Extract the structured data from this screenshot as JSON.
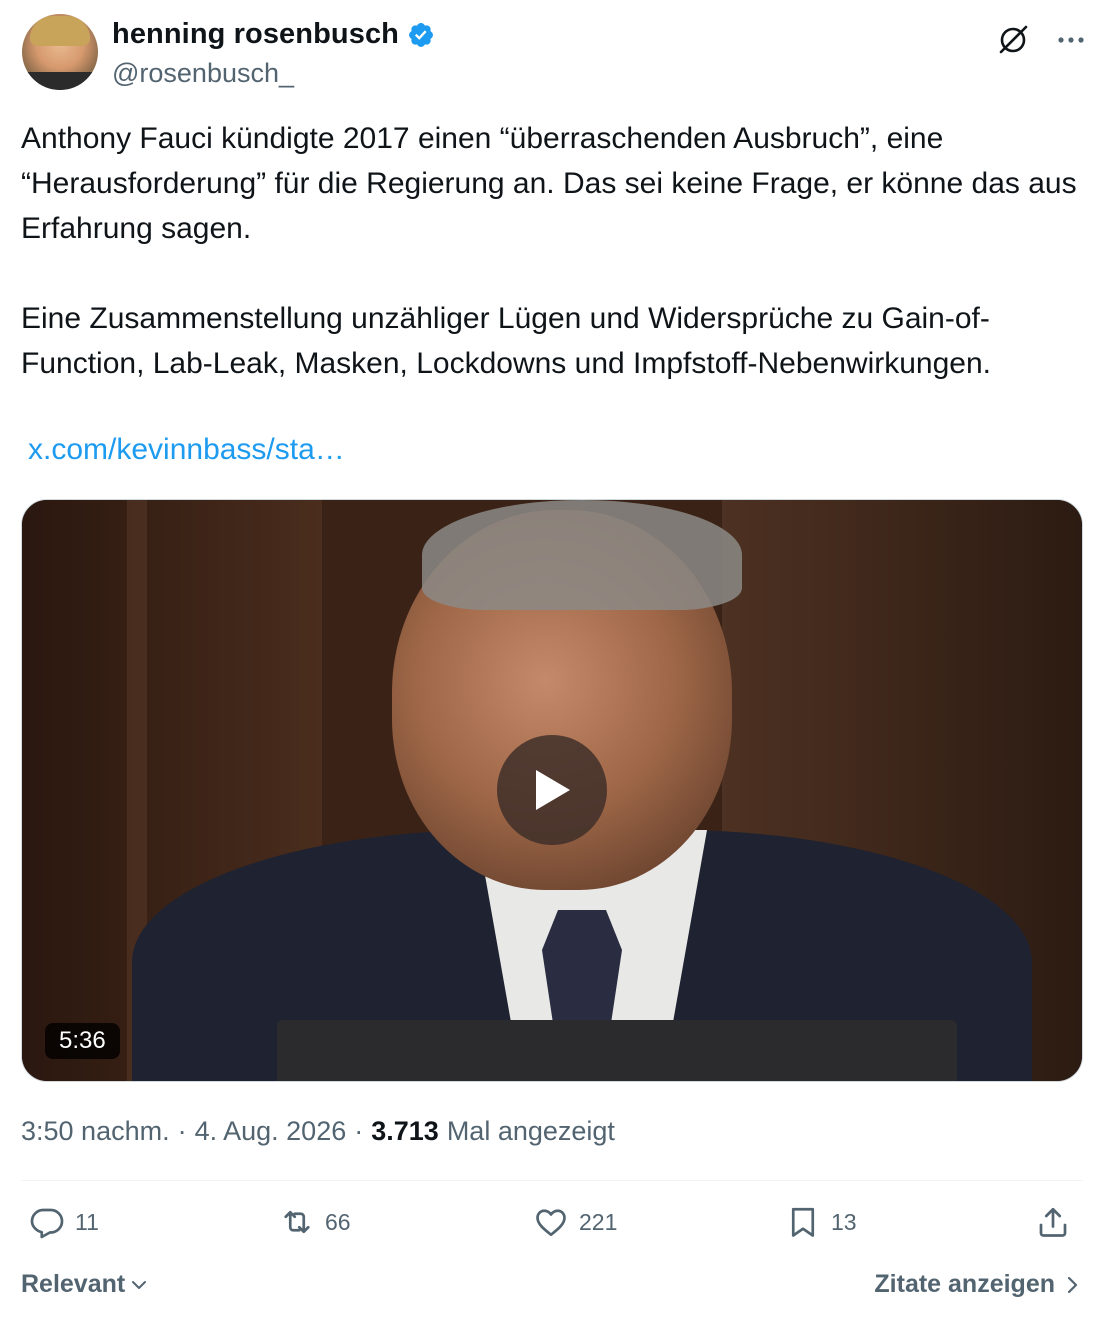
{
  "author": {
    "name": "henning rosenbusch",
    "handle": "@rosenbusch_",
    "verified": true
  },
  "icons": {
    "verified": "verified-badge-icon",
    "grok": "grok-icon",
    "more": "more-icon",
    "reply": "reply-icon",
    "retweet": "retweet-icon",
    "like": "like-icon",
    "bookmark": "bookmark-icon",
    "share": "share-icon"
  },
  "colors": {
    "accent": "#1d9bf0",
    "text": "#0f1419",
    "secondary": "#536471"
  },
  "tweet": {
    "text": "Anthony Fauci kündigte 2017 einen “überraschenden Ausbruch”, eine “Herausforderung” für die Regierung an. Das sei keine Frage, er könne das aus Erfahrung sagen.\n\nEine Zusammenstellung unzähliger Lügen und Widersprüche zu Gain-of-Function, Lab-Leak, Masken, Lockdowns und Impfstoff-Nebenwirkungen.",
    "link": "x.com/kevinnbass/sta…"
  },
  "video": {
    "duration": "5:36"
  },
  "meta": {
    "time": "3:50 nachm.",
    "separator": "·",
    "date": "4. Aug. 2026",
    "views_count": "3.713",
    "views_label": "Mal angezeigt"
  },
  "actions": {
    "replies": "11",
    "retweets": "66",
    "likes": "221",
    "bookmarks": "13"
  },
  "footer": {
    "sort_label": "Relevant",
    "quotes_label": "Zitate anzeigen"
  }
}
